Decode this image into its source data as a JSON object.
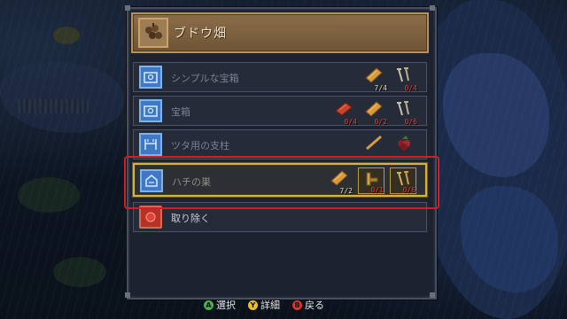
{
  "menu": {
    "title": "ブドウ畑",
    "items": [
      {
        "label": "シンプルな宝箱",
        "icon": "chest-blueprint-icon",
        "ingredients": [
          {
            "icon": "wood-plank-icon",
            "count": "7/4",
            "short": false
          },
          {
            "icon": "nails-icon",
            "count": "0/4",
            "short": true
          }
        ]
      },
      {
        "label": "宝箱",
        "icon": "chest-blueprint-icon",
        "ingredients": [
          {
            "icon": "clay-brick-icon",
            "count": "0/4",
            "short": true
          },
          {
            "icon": "wood-plank-icon",
            "count": "0/2",
            "short": true
          },
          {
            "icon": "nails-icon",
            "count": "0/6",
            "short": true
          }
        ]
      },
      {
        "label": "ツタ用の支柱",
        "icon": "trellis-blueprint-icon",
        "ingredients": [
          {
            "icon": "stick-icon",
            "count": "",
            "short": false
          },
          {
            "icon": "berries-icon",
            "count": "",
            "short": false
          }
        ]
      },
      {
        "label": "ハチの巣",
        "icon": "beehive-blueprint-icon",
        "selected": true,
        "ingredients": [
          {
            "icon": "wood-plank-icon",
            "count": "7/2",
            "short": false
          },
          {
            "icon": "hinge-icon",
            "count": "0/1",
            "short": true
          },
          {
            "icon": "nails-icon",
            "count": "0/6",
            "short": true
          }
        ]
      }
    ],
    "remove_label": "取り除く"
  },
  "footer": {
    "actions": [
      {
        "button": "A",
        "label": "選択",
        "color": "#4caf50"
      },
      {
        "button": "Y",
        "label": "詳細",
        "color": "#e8c22e"
      },
      {
        "button": "B",
        "label": "戻る",
        "color": "#d9352a"
      }
    ]
  },
  "colors": {
    "selection_outline": "#d01e2a",
    "selected_row_border": "#d6b33a",
    "count_short": "#e2413b",
    "count_ok": "#e8d9b8"
  }
}
